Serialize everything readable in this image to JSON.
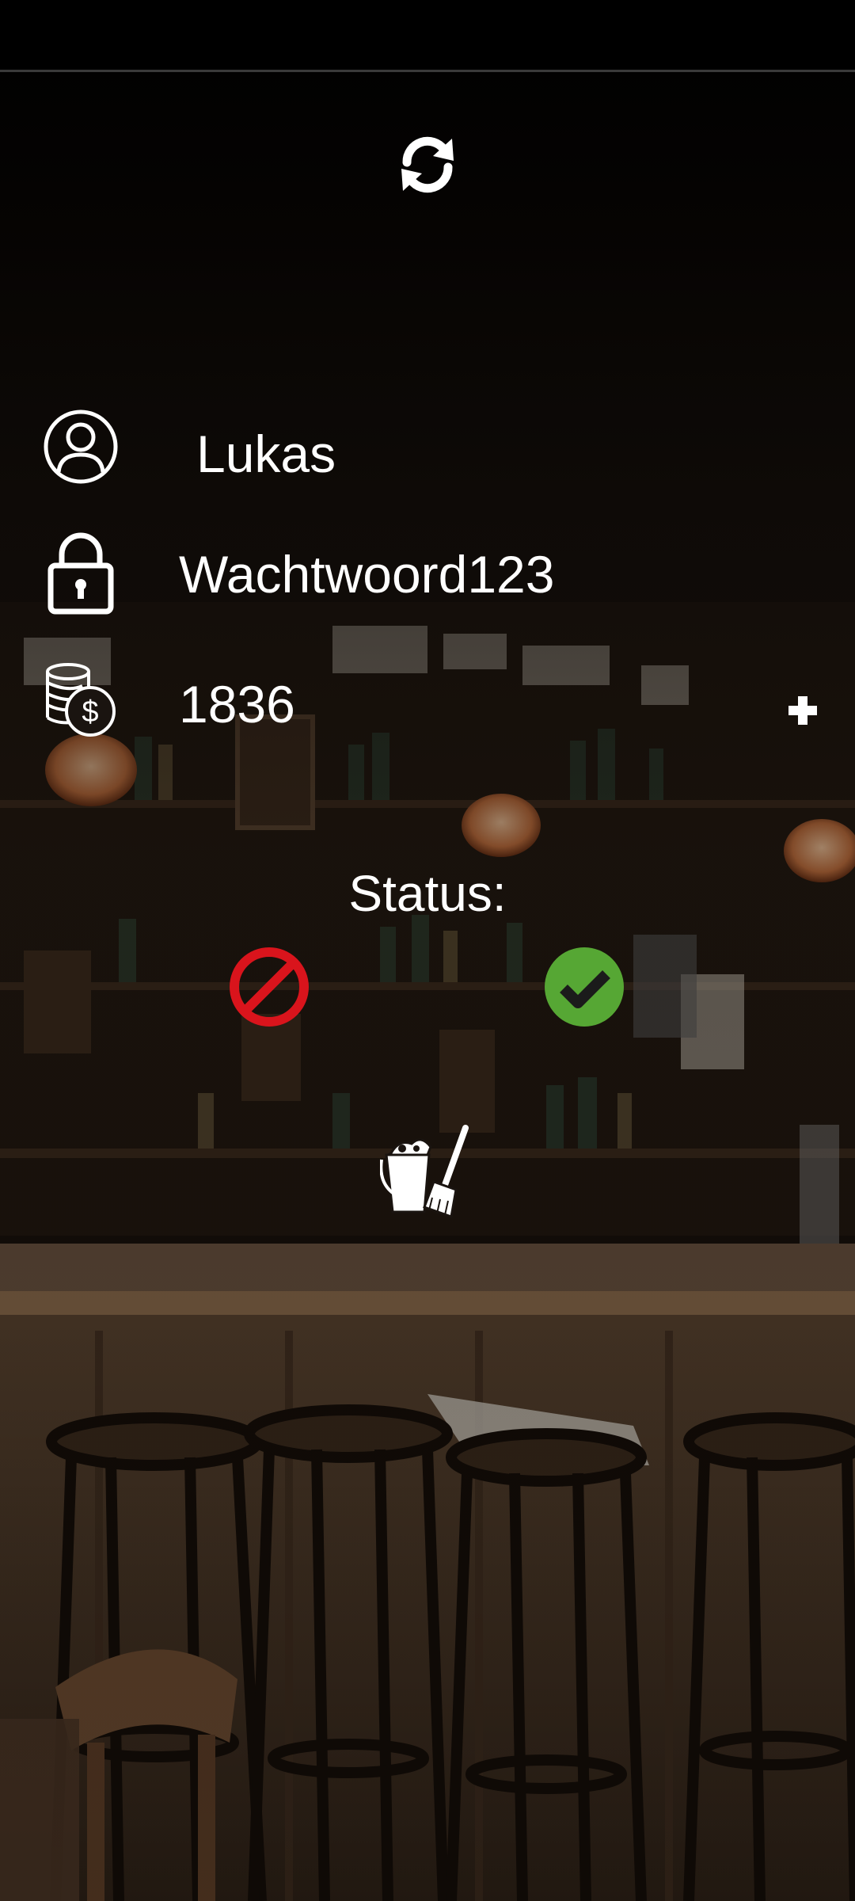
{
  "account": {
    "username": "Lukas",
    "password": "Wachtwoord123",
    "balance": "1836"
  },
  "status": {
    "label": "Status:"
  },
  "icons": {
    "refresh": "refresh-icon",
    "user": "user-icon",
    "lock": "lock-icon",
    "coins": "coins-dollar-icon",
    "add": "plus-icon",
    "closed": "prohibited-icon",
    "open": "check-icon",
    "cleaning": "bucket-broom-icon"
  },
  "colors": {
    "text": "#ffffff",
    "closed": "#d9141c",
    "open": "#56a734",
    "background_tint": "#1a120c"
  }
}
